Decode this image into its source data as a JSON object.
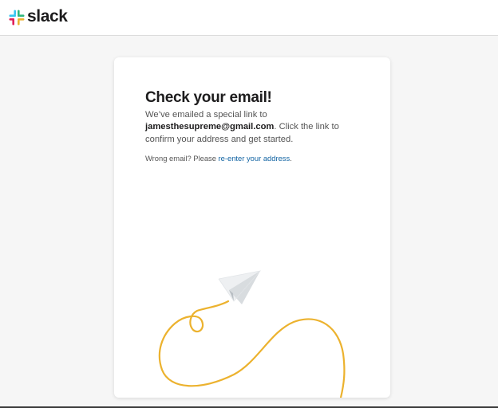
{
  "header": {
    "brand_name": "slack",
    "logo_icon": "slack-logo-icon"
  },
  "card": {
    "title": "Check your email!",
    "message_prefix": "We’ve emailed a special link to ",
    "email": "jamesthesupreme@gmail.com",
    "message_suffix": ". Click the link to confirm your address and get started.",
    "wrong_email_prefix": "Wrong email? Please ",
    "reenter_link_label": "re-enter your address",
    "wrong_email_suffix": ".",
    "illustration_icon": "paper-plane-icon"
  },
  "colors": {
    "page_background": "#f6f6f6",
    "link": "#1264a3",
    "flight_path": "#ecb22e",
    "text_primary": "#1d1c1d",
    "text_secondary": "#555555"
  }
}
